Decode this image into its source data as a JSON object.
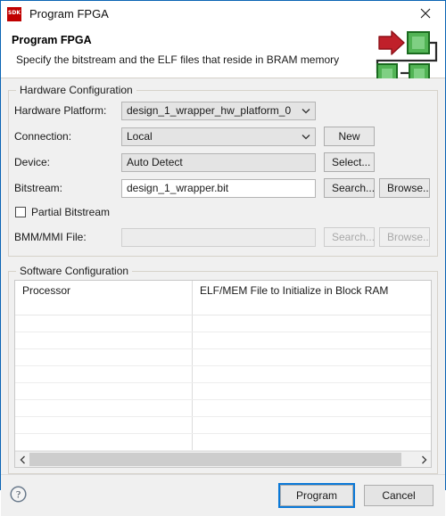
{
  "window": {
    "title": "Program FPGA",
    "icon": "sdk-icon",
    "close_icon": "close-icon"
  },
  "header": {
    "title": "Program FPGA",
    "subtitle": "Specify the bitstream and the ELF files that reside in BRAM memory",
    "art_icon": "fpga-diagram-icon",
    "art_colors": {
      "arrow": "#c0202a",
      "block": "#4caf50",
      "block_border": "#1a6b1f",
      "wire": "#2b2b2b"
    }
  },
  "hardware_configuration": {
    "group_label": "Hardware Configuration",
    "hardware_platform": {
      "label": "Hardware Platform:",
      "value": "design_1_wrapper_hw_platform_0"
    },
    "connection": {
      "label": "Connection:",
      "value": "Local",
      "new_button": "New"
    },
    "device": {
      "label": "Device:",
      "value": "Auto Detect",
      "select_button": "Select..."
    },
    "bitstream": {
      "label": "Bitstream:",
      "value": "design_1_wrapper.bit",
      "placeholder": "",
      "search_button": "Search...",
      "browse_button": "Browse.."
    },
    "partial_bitstream": {
      "label": "Partial Bitstream",
      "checked": false
    },
    "bmm_mmi_file": {
      "label": "BMM/MMI File:",
      "value": "",
      "placeholder": "",
      "search_button": "Search...",
      "browse_button": "Browse..",
      "disabled": true
    }
  },
  "software_configuration": {
    "group_label": "Software Configuration",
    "table": {
      "columns": [
        "Processor",
        "ELF/MEM File to Initialize in Block RAM"
      ],
      "rows": [],
      "empty_row_count": 8
    },
    "scrollbar": {
      "left_icon": "chevron-left-icon",
      "right_icon": "chevron-right-icon"
    }
  },
  "footer": {
    "help_icon": "help-icon",
    "program_button": "Program",
    "cancel_button": "Cancel"
  }
}
